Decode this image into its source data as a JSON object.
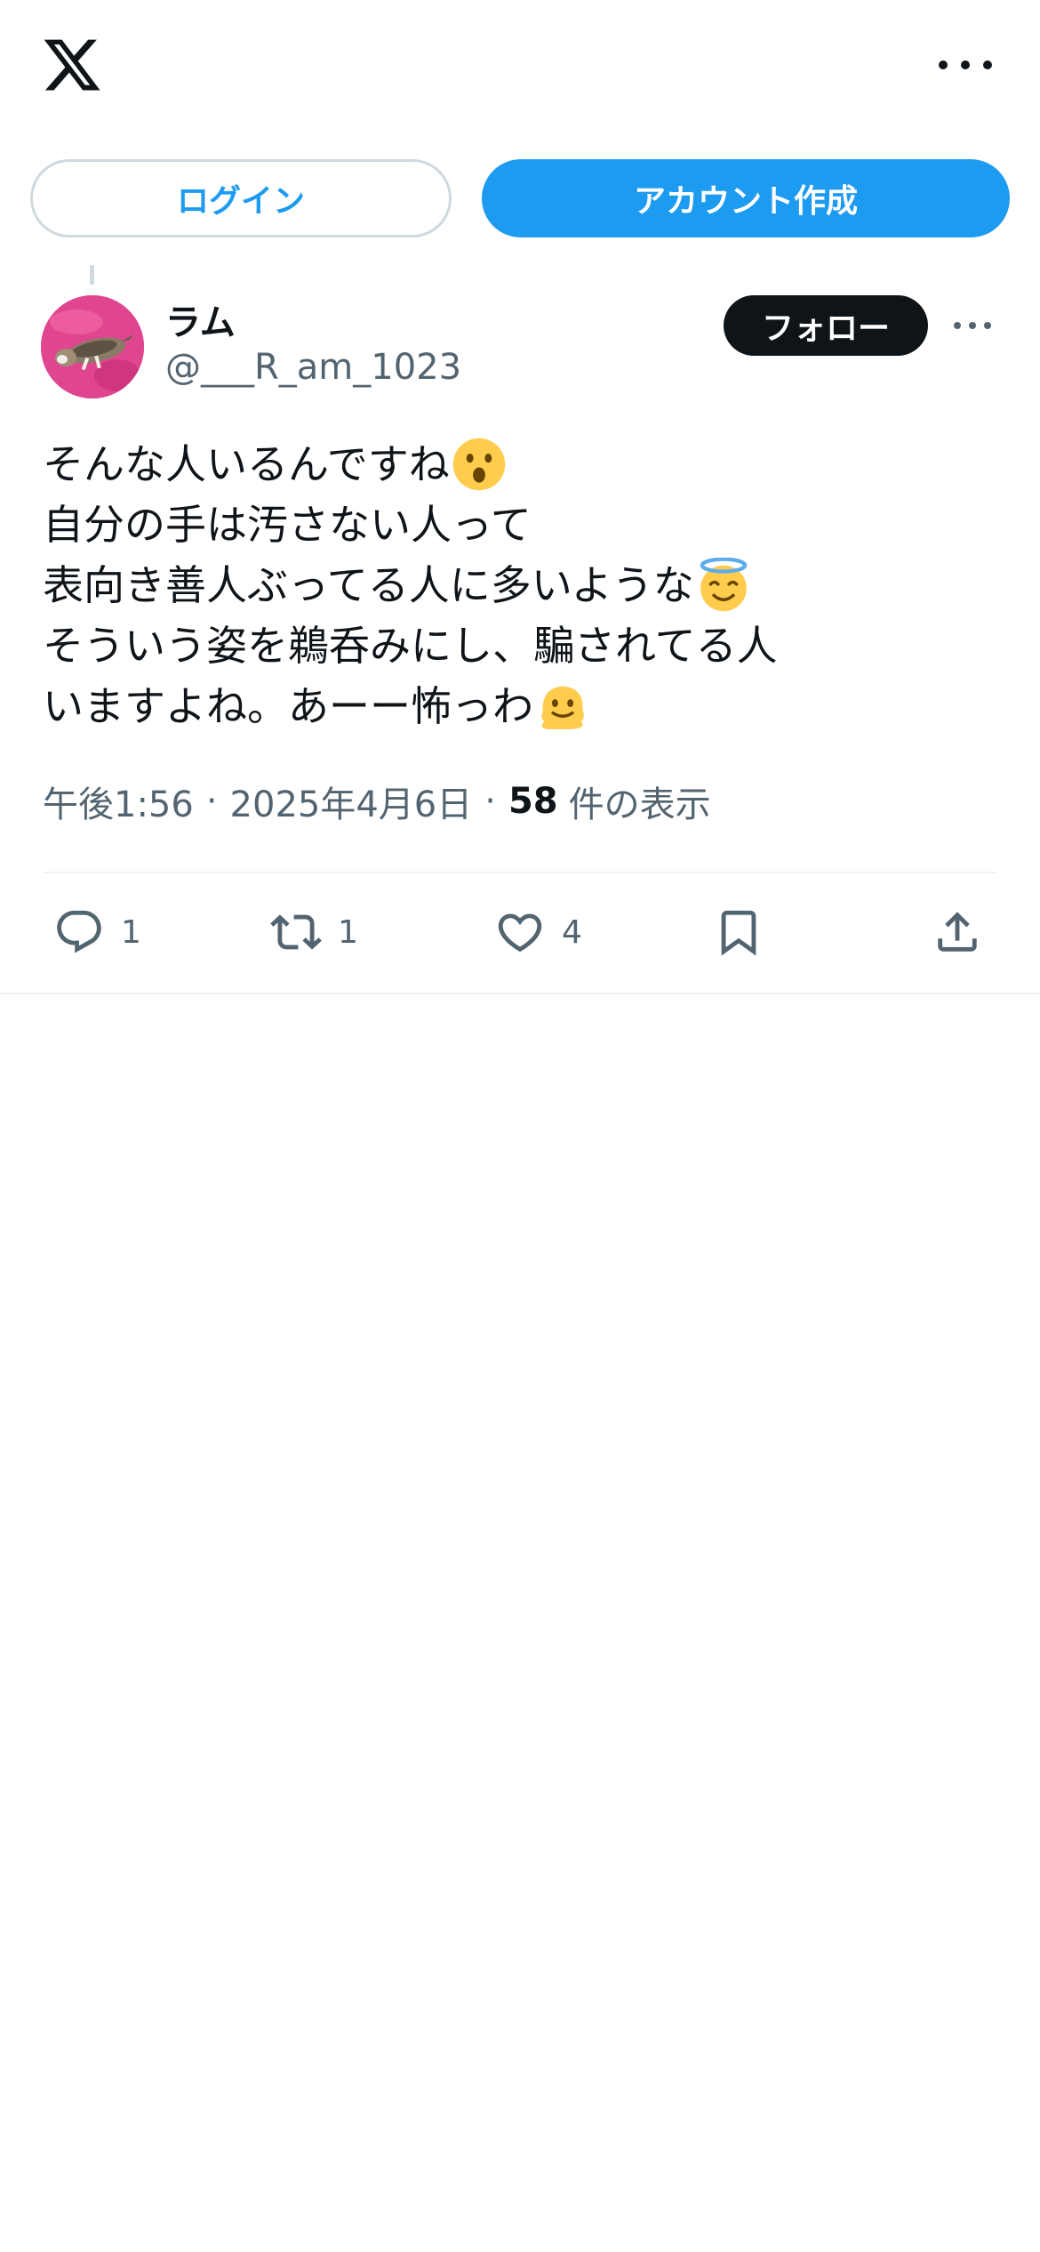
{
  "header": {
    "logo_icon": "x-logo-icon",
    "more_icon": "more-horizontal-icon"
  },
  "auth": {
    "login_label": "ログイン",
    "signup_label": "アカウント作成",
    "accent_color": "#1d9bf0"
  },
  "post": {
    "display_name": "ラム",
    "handle": "@___R_am_1023",
    "follow_label": "フォロー",
    "avatar_icon": "cat-photo-avatar",
    "text_lines": [
      {
        "text": "そんな人いるんですね",
        "emoji": "astonished-face-icon"
      },
      {
        "text": "自分の手は汚さない人って",
        "emoji": ""
      },
      {
        "text": "表向き善人ぶってる人に多いような",
        "emoji": "smiling-face-with-halo-icon"
      },
      {
        "text": "そういう姿を鵜呑みにし、騙されてる人",
        "emoji": ""
      },
      {
        "text": "いますよね。あーー怖っわ",
        "emoji": "melting-face-icon"
      }
    ],
    "time": "午後1:56",
    "date": "2025年4月6日",
    "separator": "·",
    "views_count": "58",
    "views_label": "件の表示"
  },
  "actions": {
    "reply_count": "1",
    "retweet_count": "1",
    "like_count": "4",
    "icons": [
      "reply-icon",
      "retweet-icon",
      "like-icon",
      "bookmark-icon",
      "share-icon"
    ]
  }
}
